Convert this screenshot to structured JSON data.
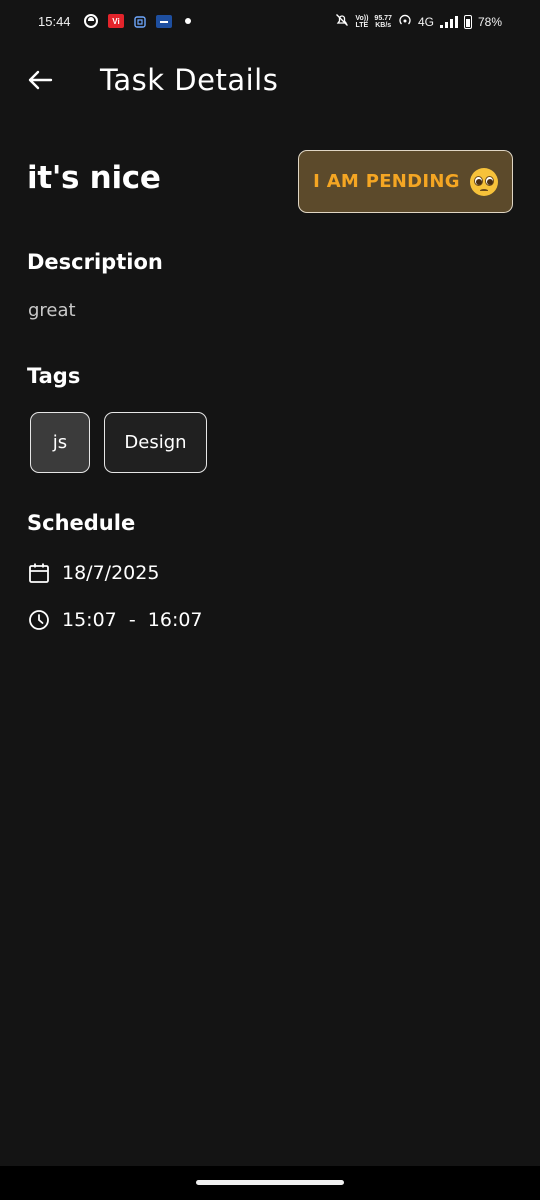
{
  "status_bar": {
    "time": "15:44",
    "vi_label": "Vi",
    "volte_top": "Vo))",
    "volte_bottom": "LTE",
    "speed_top": "95.77",
    "speed_bottom": "KB/s",
    "network": "4G",
    "battery": "78%"
  },
  "header": {
    "title": "Task Details",
    "back_icon": "arrow-left-icon"
  },
  "task": {
    "title": "it's nice",
    "status_label": "I AM PENDING",
    "status_emoji": "pleading-face-emoji",
    "status_color": "#f5a623",
    "status_bg": "#5c4a2b"
  },
  "description": {
    "label": "Description",
    "text": "great"
  },
  "tags": {
    "label": "Tags",
    "items": [
      "js",
      "Design"
    ]
  },
  "schedule": {
    "label": "Schedule",
    "date_icon": "calendar-icon",
    "date": "18/7/2025",
    "time_icon": "clock-icon",
    "time_range": "15:07  -  16:07"
  },
  "colors": {
    "background": "#141414",
    "accent": "#f5a623"
  }
}
